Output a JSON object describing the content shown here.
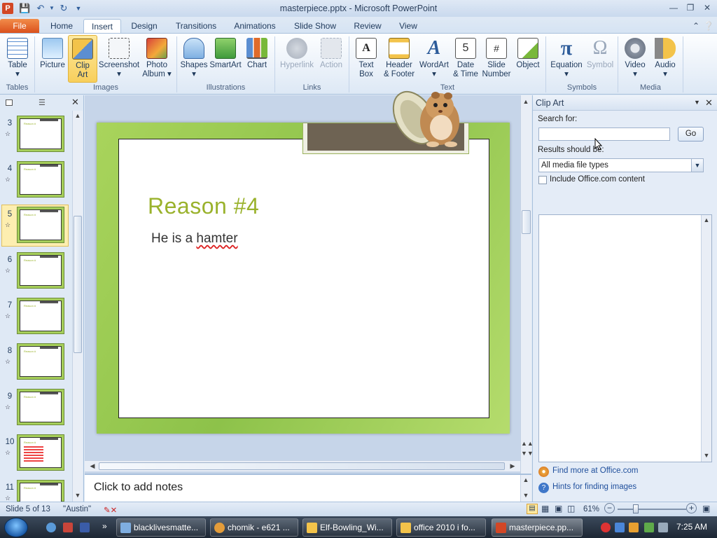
{
  "window": {
    "title": "masterpiece.pptx - Microsoft PowerPoint",
    "app_icon": "P",
    "qa_save_icon": "save-icon",
    "qa_undo_icon": "undo-icon",
    "qa_redo_icon": "redo-icon"
  },
  "tabs": [
    {
      "label": "File"
    },
    {
      "label": "Home"
    },
    {
      "label": "Insert"
    },
    {
      "label": "Design"
    },
    {
      "label": "Transitions"
    },
    {
      "label": "Animations"
    },
    {
      "label": "Slide Show"
    },
    {
      "label": "Review"
    },
    {
      "label": "View"
    }
  ],
  "ribbon": {
    "table": "Table",
    "picture": "Picture",
    "clip_art": [
      "Clip",
      "Art"
    ],
    "screenshot": "Screenshot",
    "photo_album": [
      "Photo",
      "Album ▾"
    ],
    "shapes": "Shapes",
    "smartart": "SmartArt",
    "chart": "Chart",
    "hyperlink": "Hyperlink",
    "action": "Action",
    "text_box": [
      "Text",
      "Box"
    ],
    "header_footer": [
      "Header",
      "& Footer"
    ],
    "wordart": "WordArt",
    "date_time": [
      "Date",
      "& Time"
    ],
    "slide_number": [
      "Slide",
      "Number"
    ],
    "object": "Object",
    "equation": "Equation",
    "symbol": "Symbol",
    "video": "Video",
    "audio": "Audio",
    "groups": {
      "tables": "Tables",
      "images": "Images",
      "illustrations": "Illustrations",
      "links": "Links",
      "text": "Text",
      "symbols": "Symbols",
      "media": "Media"
    }
  },
  "slides": {
    "numbers": [
      "3",
      "4",
      "5",
      "6",
      "7",
      "8",
      "9",
      "10",
      "11"
    ],
    "selected": "5",
    "title_prefix": "Reason #"
  },
  "slide": {
    "title": "Reason #4",
    "body_prefix": "He is a ",
    "body_misspelled": "hamter"
  },
  "notes": {
    "placeholder": "Click to add notes"
  },
  "clip_art": {
    "pane_title": "Clip Art",
    "search_label": "Search for:",
    "search_value": "",
    "go_label": "Go",
    "results_label": "Results should be:",
    "results_value": "All media file types",
    "include_label": "Include Office.com content",
    "include_checked": false,
    "find_more": "Find more at Office.com",
    "hints": "Hints for finding images"
  },
  "status": {
    "slide_info": "Slide 5 of 13",
    "theme": "\"Austin\"",
    "zoom": "61%"
  },
  "taskbar": {
    "items": [
      {
        "label": "blacklivesmatte..."
      },
      {
        "label": "chomik - e621 ..."
      },
      {
        "label": "Elf-Bowling_Wi..."
      },
      {
        "label": "office 2010 i fo..."
      },
      {
        "label": "masterpiece.pp..."
      }
    ],
    "clock": "7:25 AM"
  }
}
